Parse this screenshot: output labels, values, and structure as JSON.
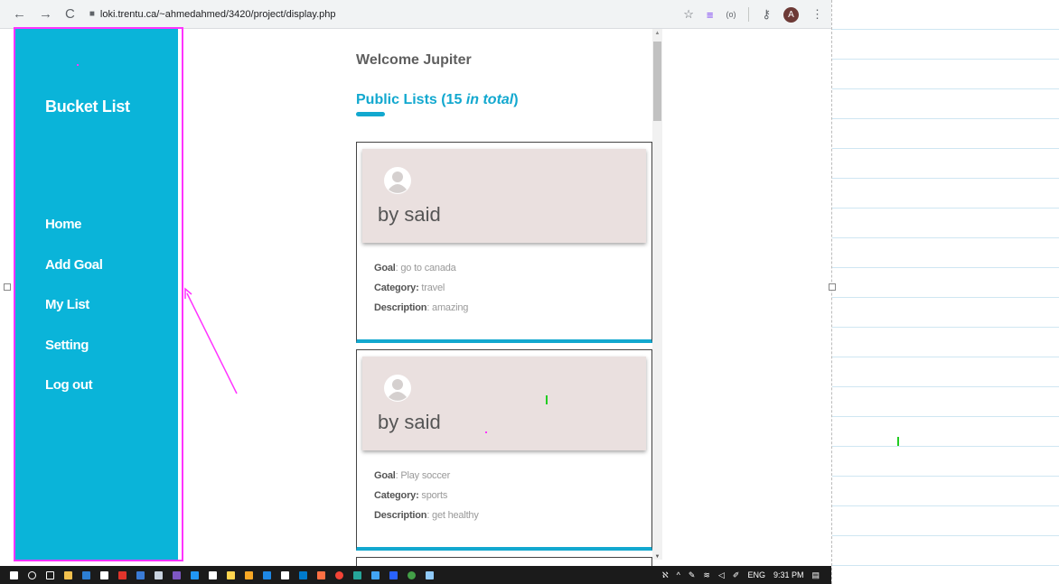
{
  "browser": {
    "url": "loki.trentu.ca/~ahmedahmed/3420/project/display.php",
    "avatar_letter": "A"
  },
  "sidebar": {
    "brand": "Bucket List",
    "items": [
      {
        "label": "Home"
      },
      {
        "label": "Add Goal"
      },
      {
        "label": "My List"
      },
      {
        "label": "Setting"
      },
      {
        "label": "Log out"
      }
    ]
  },
  "main": {
    "welcome": "Welcome Jupiter",
    "public_prefix": "Public Lists (15 ",
    "public_italic": "in total",
    "public_suffix": ")",
    "field_labels": {
      "goal": "Goal",
      "category": "Category:",
      "description": "Description"
    },
    "cards": [
      {
        "by": "by said",
        "goal": "go to canada",
        "category": "travel",
        "description": "amazing"
      },
      {
        "by": "by said",
        "goal": "Play soccer",
        "category": "sports",
        "description": "get healthy"
      }
    ]
  },
  "taskbar": {
    "language": "ENG",
    "time": "9:31 PM"
  },
  "colors": {
    "sidebar_bg": "#0ab4d9",
    "accent": "#12a8cf",
    "card_header_bg": "#eae0df",
    "annotation": "#ff33ff"
  }
}
